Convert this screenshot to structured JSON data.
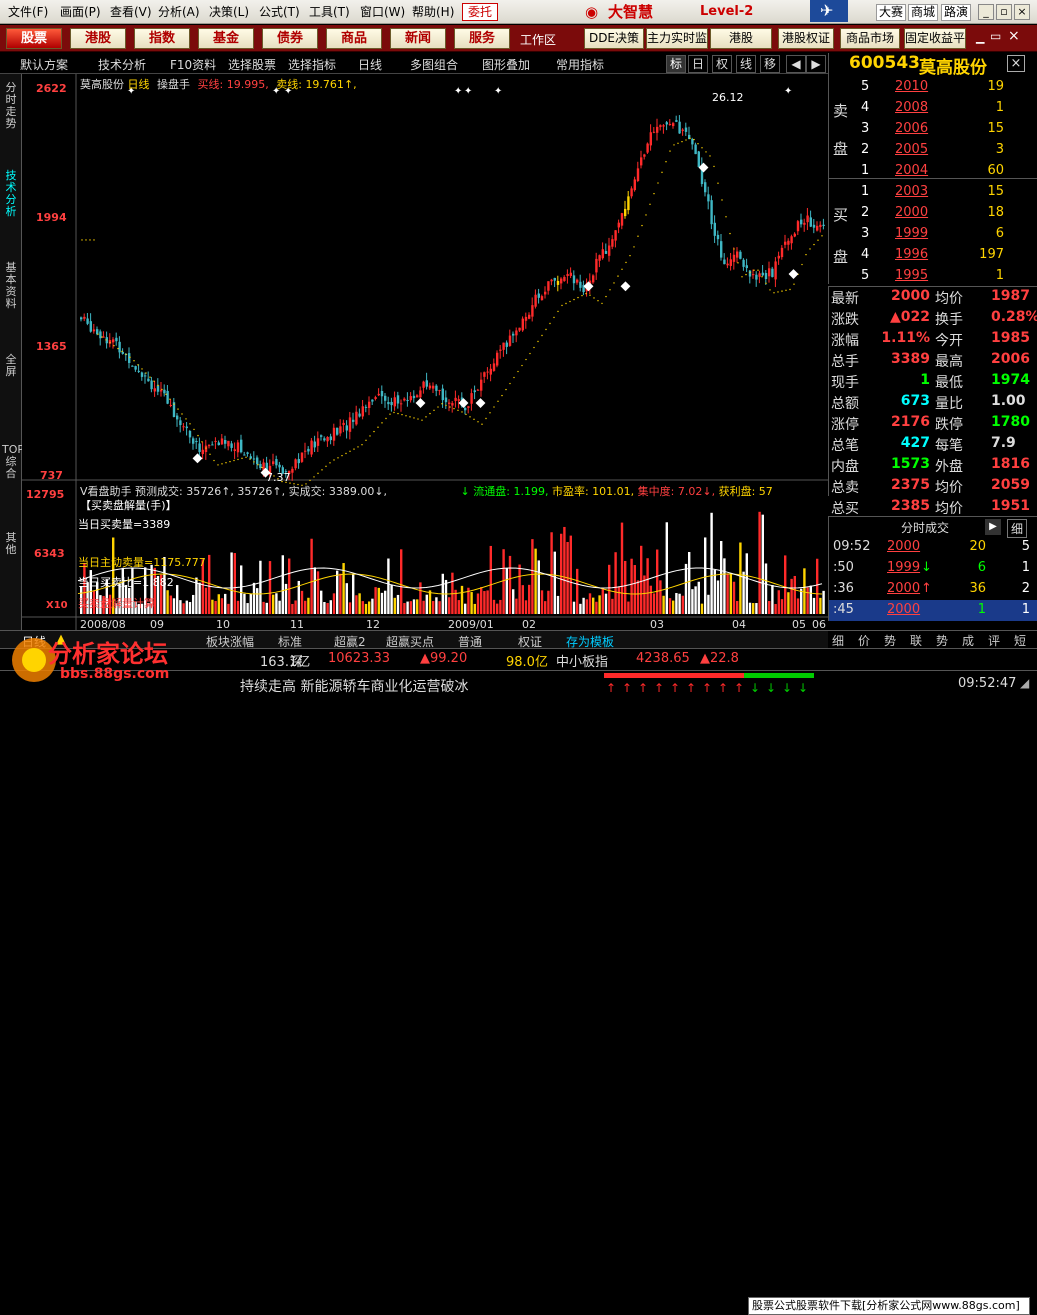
{
  "menu": [
    "文件(F)",
    "画面(P)",
    "查看(V)",
    "分析(A)",
    "决策(L)",
    "公式(T)",
    "工具(T)",
    "窗口(W)",
    "帮助(H)"
  ],
  "trade_label": "委托",
  "brand": {
    "name": "大智慧",
    "level": "Level-2"
  },
  "top_right": [
    "大赛",
    "商城",
    "路演"
  ],
  "nav_buttons": [
    "股票",
    "港股",
    "指数",
    "基金",
    "债券",
    "商品",
    "新闻",
    "服务"
  ],
  "workarea_label": "工作区",
  "nav_right": [
    "DDE决策",
    "主力实时监",
    "港股",
    "港股权证",
    "商品市场",
    "固定收益平"
  ],
  "toolbar": [
    "默认方案",
    "技术分析",
    "F10资料",
    "选择股票",
    "选择指标",
    "日线",
    "多图组合",
    "图形叠加",
    "常用指标"
  ],
  "view_toggles": [
    "标",
    "日",
    "权",
    "线",
    "移"
  ],
  "stock": {
    "code": "600543",
    "name": "莫高股份"
  },
  "left_strip": [
    "分时走势",
    "技术分析",
    "基本资料",
    "全屏",
    "TOP综合",
    "其他"
  ],
  "main_header": {
    "name": "莫高股份",
    "period": "日线",
    "indicator": "操盘手",
    "buy_label": "买线:",
    "buy_val": "19.995",
    "sell_label": "卖线:",
    "sell_val": "19.761"
  },
  "main_y_labels": [
    "2622",
    "1994",
    "1365",
    "737"
  ],
  "vol_y_labels": [
    "12795",
    "6343",
    "X10"
  ],
  "annotations": {
    "high": "26.12",
    "low": "7.37"
  },
  "volume_header": {
    "text": "V看盘助手 预测成交: 35726↑, 35726↑, 实成交: 3389.00↓,",
    "liquid": "↓ 流通盘: 1.199,",
    "pe": "市盈率: 101.01,",
    "concentration": "集中度: 7.02↓,",
    "profit": "获利盘: 57"
  },
  "volume_notes": [
    "【买卖盘解量(手)】",
    "当日买卖量=3389",
    "当日主动卖量=1175.777",
    "当日买卖比=1.882",
    "买卖盘解量计算"
  ],
  "x_labels": [
    "2008/08",
    "09",
    "10",
    "11",
    "12",
    "2009/01",
    "02",
    "03",
    "04",
    "05",
    "06"
  ],
  "order_book": {
    "sell_label": "卖盘",
    "buy_label": "买盘",
    "sell": [
      {
        "level": "5",
        "price": "2010",
        "vol": "19"
      },
      {
        "level": "4",
        "price": "2008",
        "vol": "1"
      },
      {
        "level": "3",
        "price": "2006",
        "vol": "15"
      },
      {
        "level": "2",
        "price": "2005",
        "vol": "3"
      },
      {
        "level": "1",
        "price": "2004",
        "vol": "60"
      }
    ],
    "buy": [
      {
        "level": "1",
        "price": "2003",
        "vol": "15"
      },
      {
        "level": "2",
        "price": "2000",
        "vol": "18"
      },
      {
        "level": "3",
        "price": "1999",
        "vol": "6"
      },
      {
        "level": "4",
        "price": "1996",
        "vol": "197"
      },
      {
        "level": "5",
        "price": "1995",
        "vol": "1"
      }
    ]
  },
  "quote": [
    {
      "l1": "最新",
      "v1": "2000",
      "l2": "均价",
      "v2": "1987"
    },
    {
      "l1": "涨跌",
      "v1": "▲022",
      "l2": "换手",
      "v2": "0.28%"
    },
    {
      "l1": "涨幅",
      "v1": "1.11%",
      "l2": "今开",
      "v2": "1985"
    },
    {
      "l1": "总手",
      "v1": "3389",
      "l2": "最高",
      "v2": "2006"
    },
    {
      "l1": "现手",
      "v1": "1",
      "l2": "最低",
      "v2": "1974"
    },
    {
      "l1": "总额",
      "v1": "673",
      "l2": "量比",
      "v2": "1.00"
    },
    {
      "l1": "涨停",
      "v1": "2176",
      "l2": "跌停",
      "v2": "1780"
    },
    {
      "l1": "总笔",
      "v1": "427",
      "l2": "每笔",
      "v2": "7.9"
    },
    {
      "l1": "内盘",
      "v1": "1573",
      "l2": "外盘",
      "v2": "1816"
    },
    {
      "l1": "总卖",
      "v1": "2375",
      "l2": "均价",
      "v2": "2059"
    },
    {
      "l1": "总买",
      "v1": "2385",
      "l2": "均价",
      "v2": "1951"
    }
  ],
  "tick_header": {
    "label": "分时成交",
    "detail": "细"
  },
  "ticks": [
    {
      "time": "09:52",
      "price": "2000",
      "vol": "20",
      "cnt": "5",
      "arrow": ""
    },
    {
      "time": ":50",
      "price": "1999",
      "vol": "6",
      "cnt": "1",
      "arrow": "↓"
    },
    {
      "time": ":36",
      "price": "2000",
      "vol": "36",
      "cnt": "2",
      "arrow": "↑"
    },
    {
      "time": ":45",
      "price": "2000",
      "vol": "1",
      "cnt": "1",
      "arrow": ""
    }
  ],
  "bottom_tabs_right": [
    "细",
    "价",
    "势",
    "联",
    "势",
    "成",
    "评",
    "短"
  ],
  "bottom_subtabs": [
    "日线",
    "板块涨幅",
    "标准",
    "超赢2",
    "超赢买点",
    "普通",
    "权证",
    "存为模板"
  ],
  "ticker": {
    "a": "163.1亿",
    "b": "深",
    "c": "10623.33",
    "d": "▲99.20",
    "e": "98.0亿",
    "f": "中小板指",
    "g": "4238.65",
    "h": "▲22.8"
  },
  "news": "持续走高 新能源轿车商业化运营破冰",
  "news_banner": "股票公式股票软件下载[分析家公式网www.88gs.com]",
  "watermark": {
    "line1": "分析家论坛",
    "line2": "bbs.88gs.com"
  },
  "clock": "09:52:47",
  "colors": {
    "up": "#ff2a2a",
    "down": "#3fb7c4",
    "yellow": "#ffd400",
    "accent": "#b00000"
  }
}
